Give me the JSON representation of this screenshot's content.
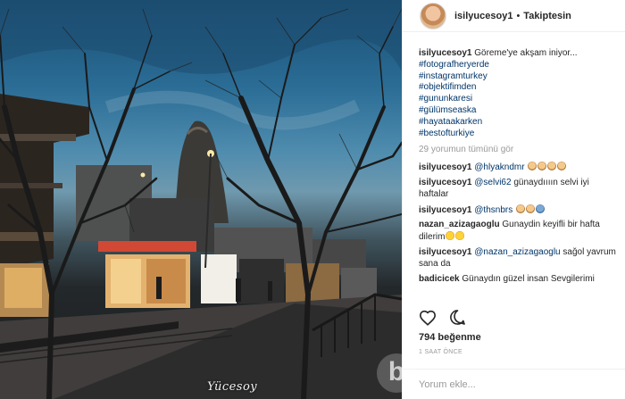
{
  "header": {
    "username": "isilyucesoy1",
    "separator": "•",
    "follow_label": "Takiptesin"
  },
  "caption": {
    "username": "isilyucesoy1",
    "text": "Göreme'ye akşam iniyor...",
    "hashtags": [
      "#fotografheryerde",
      "#instagramturkey",
      "#objektifimden",
      "#gununkaresi",
      "#gülümseaska",
      "#hayataakarken",
      "#bestofturkiye"
    ]
  },
  "view_all_label": "29 yorumun tümünü gör",
  "comments": [
    {
      "username": "isilyucesoy1",
      "mention": "@hlyakndmr",
      "text": "",
      "emoji": [
        "face",
        "face",
        "face",
        "face"
      ]
    },
    {
      "username": "isilyucesoy1",
      "mention": "@selvi62",
      "text": " günaydıııın selvi iyi haftalar",
      "emoji": []
    },
    {
      "username": "isilyucesoy1",
      "mention": "@thsnbrs",
      "text": "",
      "emoji": [
        "face",
        "face",
        "hands"
      ]
    },
    {
      "username": "nazan_azizagaoglu",
      "mention": "",
      "text": "Gunaydin keyifli bir hafta dilerim",
      "emoji": [
        "smile",
        "smile"
      ]
    },
    {
      "username": "isilyucesoy1",
      "mention": "@nazan_azizagaoglu",
      "text": " sağol yavrum sana da",
      "emoji": []
    },
    {
      "username": "badicicek",
      "mention": "",
      "text": "Günaydın güzel insan Sevgilerimi",
      "emoji": []
    }
  ],
  "likes_label": "794 beğenme",
  "time_label": "1 SAAT ÖNCE",
  "comment_input": {
    "placeholder": "Yorum ekle..."
  },
  "photo": {
    "watermark": "Yücesoy",
    "site_badge": "b"
  },
  "icons": {
    "like": "heart-icon",
    "comment": "comment-bubble-icon"
  },
  "colors": {
    "link": "#003569",
    "muted": "#999999",
    "text": "#262626"
  }
}
